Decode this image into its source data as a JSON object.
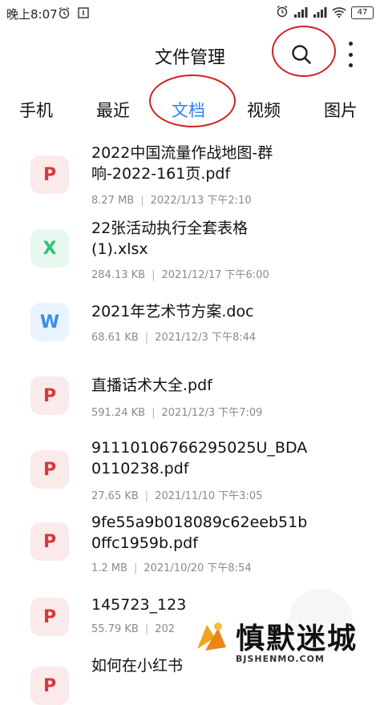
{
  "status_bar": {
    "time": "晚上8:07",
    "battery": "47",
    "icons": [
      "alarm-icon",
      "notification-icon",
      "signal-icon",
      "hd-signal-icon",
      "wifi-icon",
      "battery-icon"
    ]
  },
  "header": {
    "title": "文件管理",
    "icons": [
      "search-icon",
      "more-icon"
    ]
  },
  "tabs": [
    {
      "label": "手机",
      "active": false
    },
    {
      "label": "最近",
      "active": false
    },
    {
      "label": "文档",
      "active": true
    },
    {
      "label": "视频",
      "active": false
    },
    {
      "label": "图片",
      "active": false
    }
  ],
  "files": [
    {
      "type": "pdf",
      "icon_letter": "P",
      "name": "2022中国流量作战地图-群\n响-2022-161页.pdf",
      "size": "8.27 MB",
      "date": "2022/1/13 下午2:10"
    },
    {
      "type": "xlsx",
      "icon_letter": "X",
      "name": "22张活动执行全套表格\n(1).xlsx",
      "size": "284.13 KB",
      "date": "2021/12/17 下午6:00"
    },
    {
      "type": "doc",
      "icon_letter": "W",
      "name": "2021年艺术节方案.doc",
      "size": "68.61 KB",
      "date": "2021/12/3 下午8:44"
    },
    {
      "type": "pdf",
      "icon_letter": "P",
      "name": "直播话术大全.pdf",
      "size": "591.24 KB",
      "date": "2021/12/3 下午7:09"
    },
    {
      "type": "pdf",
      "icon_letter": "P",
      "name": "91110106766295025U_BDA\n0110238.pdf",
      "size": "27.65 KB",
      "date": "2021/11/10 下午3:05"
    },
    {
      "type": "pdf",
      "icon_letter": "P",
      "name": "9fe55a9b018089c62eeb51b\n0ffc1959b.pdf",
      "size": "1.2 MB",
      "date": "2021/10/20 下午8:54"
    },
    {
      "type": "pdf",
      "icon_letter": "P",
      "name": "145723_123",
      "size": "55.79 KB",
      "date": "202"
    },
    {
      "type": "pdf",
      "icon_letter": "P",
      "name": "如何在小红书",
      "size": "",
      "date": ""
    }
  ],
  "watermark": {
    "title": "慎默迷城",
    "subtitle": "BJSHENMO.COM"
  },
  "colors": {
    "accent": "#2d7ff9",
    "annotation": "#d32222",
    "pdf": "#d7383a",
    "xlsx": "#2ec27a",
    "doc": "#3a8ee6"
  }
}
